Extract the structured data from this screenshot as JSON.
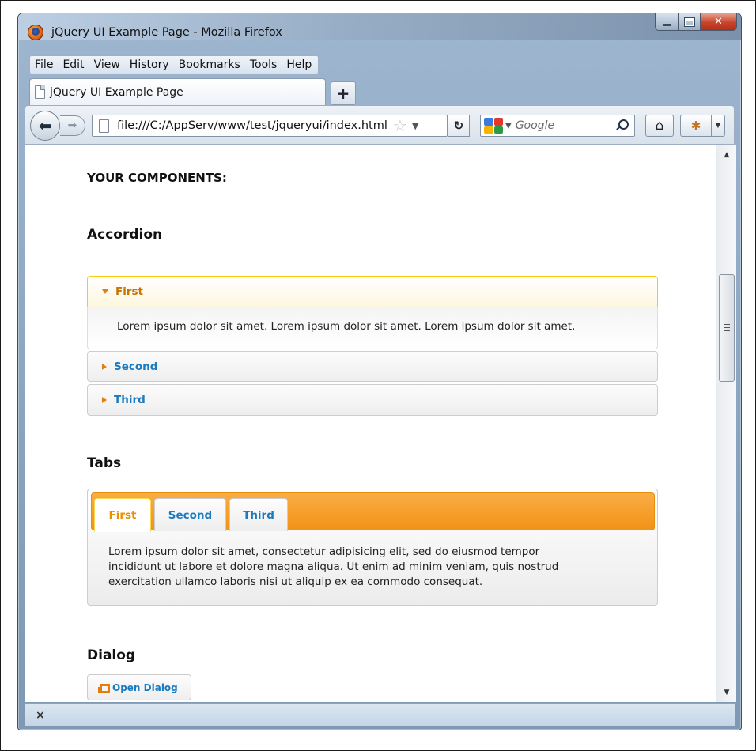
{
  "window": {
    "title": "jQuery UI Example Page - Mozilla Firefox"
  },
  "menu": [
    "File",
    "Edit",
    "View",
    "History",
    "Bookmarks",
    "Tools",
    "Help"
  ],
  "browser": {
    "tab_title": "jQuery UI Example Page",
    "url": "file:///C:/AppServ/www/test/jqueryui/index.html",
    "search_placeholder": "Google"
  },
  "page": {
    "heading": "YOUR COMPONENTS:",
    "accordion": {
      "title": "Accordion",
      "sections": [
        {
          "label": "First",
          "expanded": true,
          "content": "Lorem ipsum dolor sit amet. Lorem ipsum dolor sit amet. Lorem ipsum dolor sit amet."
        },
        {
          "label": "Second",
          "expanded": false
        },
        {
          "label": "Third",
          "expanded": false
        }
      ]
    },
    "tabs": {
      "title": "Tabs",
      "items": [
        {
          "label": "First",
          "selected": true
        },
        {
          "label": "Second",
          "selected": false
        },
        {
          "label": "Third",
          "selected": false
        }
      ],
      "panel_lines": [
        "Lorem ipsum dolor sit amet, consectetur adipisicing elit, sed do eiusmod tempor",
        "incididunt ut labore et dolore magna aliqua. Ut enim ad minim veniam, quis nostrud",
        "exercitation ullamco laboris nisi ut aliquip ex ea commodo consequat."
      ]
    },
    "dialog": {
      "title": "Dialog",
      "button_label": "Open Dialog"
    }
  },
  "statusbar": {
    "close_glyph": "×"
  },
  "colors": {
    "accent_orange": "#f6a02d",
    "link_blue": "#1c7bbf",
    "active_tab_text": "#eb8f00"
  }
}
